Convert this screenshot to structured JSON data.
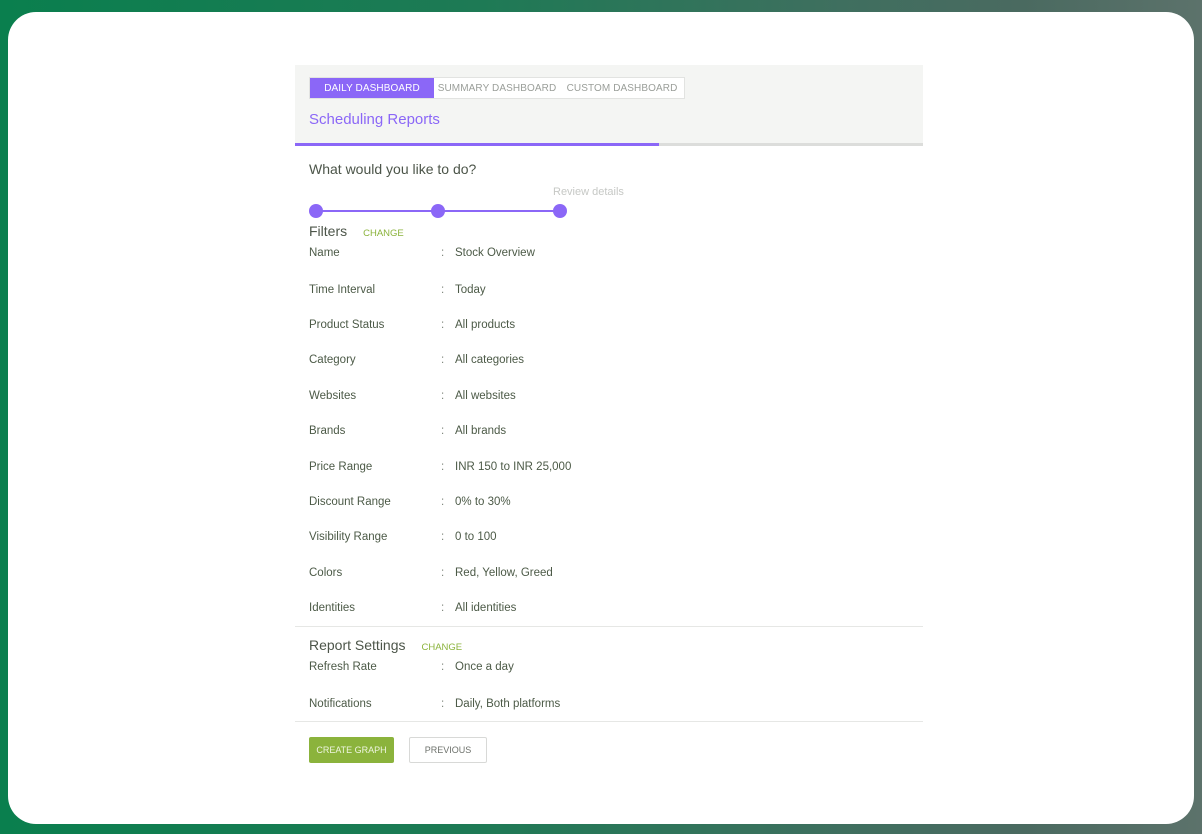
{
  "tabs": [
    {
      "label": "DAILY DASHBOARD",
      "active": true
    },
    {
      "label": "SUMMARY DASHBOARD",
      "active": false
    },
    {
      "label": "CUSTOM DASHBOARD",
      "active": false
    }
  ],
  "panel_title": "Scheduling Reports",
  "progress_percent": 58,
  "question": "What would you like to do?",
  "stepper": {
    "current_step_label": "Review details",
    "total_steps": 3,
    "current_step": 3
  },
  "filters": {
    "title": "Filters",
    "change_label": "CHANGE",
    "separator": ":",
    "rows": [
      {
        "key": "Name",
        "value": "Stock Overview"
      },
      {
        "key": "Time Interval",
        "value": "Today"
      },
      {
        "key": "Product Status",
        "value": "All products"
      },
      {
        "key": "Category",
        "value": "All categories"
      },
      {
        "key": "Websites",
        "value": "All websites"
      },
      {
        "key": "Brands",
        "value": "All brands"
      },
      {
        "key": "Price Range",
        "value": "INR 150 to INR 25,000"
      },
      {
        "key": "Discount Range",
        "value": "0% to 30%"
      },
      {
        "key": "Visibility Range",
        "value": "0 to 100"
      },
      {
        "key": "Colors",
        "value": "Red, Yellow, Greed"
      },
      {
        "key": "Identities",
        "value": "All identities"
      }
    ]
  },
  "report_settings": {
    "title": "Report Settings",
    "change_label": "CHANGE",
    "separator": ":",
    "rows": [
      {
        "key": "Refresh Rate",
        "value": "Once a day"
      },
      {
        "key": "Notifications",
        "value": "Daily, Both platforms"
      }
    ]
  },
  "actions": {
    "create_label": "CREATE GRAPH",
    "previous_label": "PREVIOUS"
  },
  "colors": {
    "accent": "#8b67f7",
    "action_green": "#8bb33c",
    "frame_green": "#0a7f4e"
  }
}
